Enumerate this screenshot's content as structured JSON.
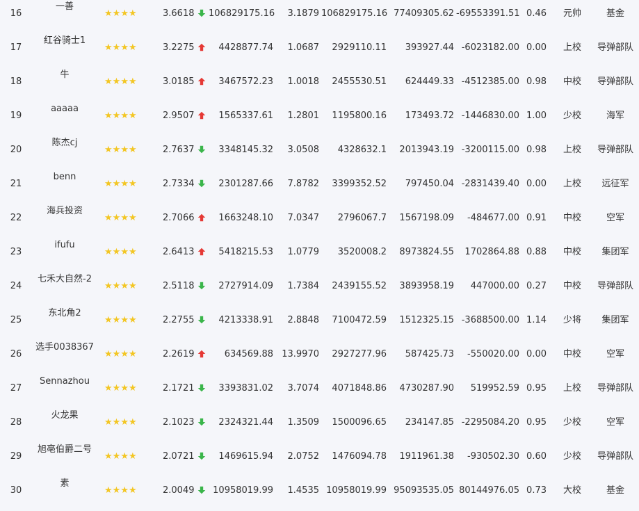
{
  "colors": {
    "background": "#f5f6fa",
    "text": "#333333",
    "star": "#f3c623",
    "trend_up": "#e53935",
    "trend_down": "#3ab54a"
  },
  "icons": {
    "star": "star-icon",
    "trend_up": "red-up-arrow-icon",
    "trend_down": "green-down-arrow-icon"
  },
  "rows": [
    {
      "rank": "16",
      "name": "一善",
      "stars": 4,
      "score": "3.6618",
      "trend": "down",
      "v1": "106829175.16",
      "v2": "3.1879",
      "v3": "106829175.16",
      "v4": "77409305.62",
      "v5": "-69553391.51",
      "ratio": "0.46",
      "rank_title": "元帅",
      "army": "基金"
    },
    {
      "rank": "17",
      "name": "红谷骑士1",
      "stars": 4,
      "score": "3.2275",
      "trend": "up",
      "v1": "4428877.74",
      "v2": "1.0687",
      "v3": "2929110.11",
      "v4": "393927.44",
      "v5": "-6023182.00",
      "ratio": "0.00",
      "rank_title": "上校",
      "army": "导弹部队"
    },
    {
      "rank": "18",
      "name": "牛",
      "stars": 4,
      "score": "3.0185",
      "trend": "up",
      "v1": "3467572.23",
      "v2": "1.0018",
      "v3": "2455530.51",
      "v4": "624449.33",
      "v5": "-4512385.00",
      "ratio": "0.98",
      "rank_title": "中校",
      "army": "导弹部队"
    },
    {
      "rank": "19",
      "name": "aaaaa",
      "stars": 4,
      "score": "2.9507",
      "trend": "up",
      "v1": "1565337.61",
      "v2": "1.2801",
      "v3": "1195800.16",
      "v4": "173493.72",
      "v5": "-1446830.00",
      "ratio": "1.00",
      "rank_title": "少校",
      "army": "海军"
    },
    {
      "rank": "20",
      "name": "陈杰cj",
      "stars": 4,
      "score": "2.7637",
      "trend": "down",
      "v1": "3348145.32",
      "v2": "3.0508",
      "v3": "4328632.1",
      "v4": "2013943.19",
      "v5": "-3200115.00",
      "ratio": "0.98",
      "rank_title": "上校",
      "army": "导弹部队"
    },
    {
      "rank": "21",
      "name": "benn",
      "stars": 4,
      "score": "2.7334",
      "trend": "down",
      "v1": "2301287.66",
      "v2": "7.8782",
      "v3": "3399352.52",
      "v4": "797450.04",
      "v5": "-2831439.40",
      "ratio": "0.00",
      "rank_title": "上校",
      "army": "远征军"
    },
    {
      "rank": "22",
      "name": "海兵投资",
      "stars": 4,
      "score": "2.7066",
      "trend": "up",
      "v1": "1663248.10",
      "v2": "7.0347",
      "v3": "2796067.7",
      "v4": "1567198.09",
      "v5": "-484677.00",
      "ratio": "0.91",
      "rank_title": "中校",
      "army": "空军"
    },
    {
      "rank": "23",
      "name": "ifufu",
      "stars": 4,
      "score": "2.6413",
      "trend": "up",
      "v1": "5418215.53",
      "v2": "1.0779",
      "v3": "3520008.2",
      "v4": "8973824.55",
      "v5": "1702864.88",
      "ratio": "0.88",
      "rank_title": "中校",
      "army": "集团军"
    },
    {
      "rank": "24",
      "name": "七禾大自然-2",
      "stars": 4,
      "score": "2.5118",
      "trend": "down",
      "v1": "2727914.09",
      "v2": "1.7384",
      "v3": "2439155.52",
      "v4": "3893958.19",
      "v5": "447000.00",
      "ratio": "0.27",
      "rank_title": "中校",
      "army": "导弹部队"
    },
    {
      "rank": "25",
      "name": "东北角2",
      "stars": 4,
      "score": "2.2755",
      "trend": "down",
      "v1": "4213338.91",
      "v2": "2.8848",
      "v3": "7100472.59",
      "v4": "1512325.15",
      "v5": "-3688500.00",
      "ratio": "1.14",
      "rank_title": "少将",
      "army": "集团军"
    },
    {
      "rank": "26",
      "name": "选手0038367",
      "stars": 4,
      "score": "2.2619",
      "trend": "up",
      "v1": "634569.88",
      "v2": "13.9970",
      "v3": "2927277.96",
      "v4": "587425.73",
      "v5": "-550020.00",
      "ratio": "0.00",
      "rank_title": "中校",
      "army": "空军"
    },
    {
      "rank": "27",
      "name": "Sennazhou",
      "stars": 4,
      "score": "2.1721",
      "trend": "down",
      "v1": "3393831.02",
      "v2": "3.7074",
      "v3": "4071848.86",
      "v4": "4730287.90",
      "v5": "519952.59",
      "ratio": "0.95",
      "rank_title": "上校",
      "army": "导弹部队"
    },
    {
      "rank": "28",
      "name": "火龙果",
      "stars": 4,
      "score": "2.1023",
      "trend": "down",
      "v1": "2324321.44",
      "v2": "1.3509",
      "v3": "1500096.65",
      "v4": "234147.85",
      "v5": "-2295084.20",
      "ratio": "0.95",
      "rank_title": "少校",
      "army": "空军"
    },
    {
      "rank": "29",
      "name": "旭亳伯爵二号",
      "stars": 4,
      "score": "2.0721",
      "trend": "down",
      "v1": "1469615.94",
      "v2": "2.0752",
      "v3": "1476094.78",
      "v4": "1911961.38",
      "v5": "-930502.30",
      "ratio": "0.60",
      "rank_title": "少校",
      "army": "导弹部队"
    },
    {
      "rank": "30",
      "name": "素",
      "stars": 4,
      "score": "2.0049",
      "trend": "down",
      "v1": "10958019.99",
      "v2": "1.4535",
      "v3": "10958019.99",
      "v4": "95093535.05",
      "v5": "80144976.05",
      "ratio": "0.73",
      "rank_title": "大校",
      "army": "基金"
    }
  ]
}
